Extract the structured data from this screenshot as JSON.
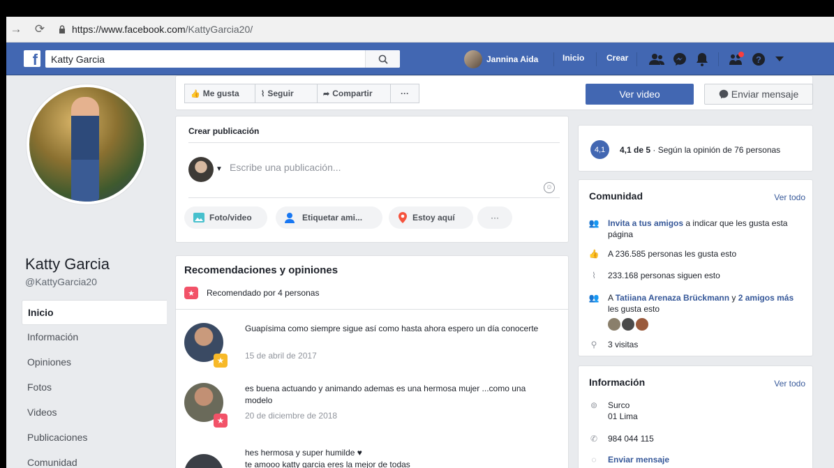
{
  "browser": {
    "url_prefix": "https://www.facebook.com",
    "url_path": "/KattyGarcia20/"
  },
  "fbbar": {
    "search_value": "Katty Garcia",
    "user_name": "Jannina Aida",
    "home_label": "Inicio",
    "create_label": "Crear"
  },
  "profile": {
    "name": "Katty Garcia",
    "handle": "@KattyGarcia20"
  },
  "left_nav": [
    {
      "label": "Inicio",
      "active": true
    },
    {
      "label": "Información"
    },
    {
      "label": "Opiniones"
    },
    {
      "label": "Fotos"
    },
    {
      "label": "Videos"
    },
    {
      "label": "Publicaciones"
    },
    {
      "label": "Comunidad"
    }
  ],
  "actions": {
    "like": "Me gusta",
    "follow": "Seguir",
    "share": "Compartir",
    "more": "···",
    "watch_video": "Ver video",
    "send_message": "Enviar mensaje"
  },
  "composer": {
    "title": "Crear publicación",
    "placeholder": "Escribe una publicación...",
    "photo": "Foto/video",
    "tag": "Etiquetar ami...",
    "checkin": "Estoy aquí",
    "more": "···"
  },
  "recommendations": {
    "title": "Recomendaciones y opiniones",
    "recommended_by": "Recomendado por 4 personas",
    "reviews": [
      {
        "text": "Guapísima como siempre sigue así como hasta ahora espero un día conocerte",
        "date": "15 de abril de 2017"
      },
      {
        "text": "es buena actuando  y animando ademas es una hermosa mujer ...como una modelo",
        "date": "20 de diciembre de 2018"
      },
      {
        "text": "hes hermosa y super humilde ♥",
        "text2": "te amooo katty garcia eres la mejor de todas"
      }
    ]
  },
  "rating": {
    "badge": "4,1",
    "score": "4,1 de 5",
    "detail": " · Según la opinión de 76 personas"
  },
  "community": {
    "title": "Comunidad",
    "see_all": "Ver todo",
    "invite_link": "Invita a tus amigos",
    "invite_rest": " a indicar que les gusta esta página",
    "likes": "A 236.585 personas les gusta esto",
    "follows": "233.168 personas siguen esto",
    "friends_prefix": "A ",
    "friends_link": "Tatiiana Arenaza Brückmann",
    "friends_mid": " y ",
    "friends_link2": "2 amigos más",
    "friends_suffix": " les gusta esto",
    "visits": "3 visitas"
  },
  "info": {
    "title": "Información",
    "see_all": "Ver todo",
    "address1": "Surco",
    "address2": "01 Lima",
    "phone": "984 044 115",
    "message_link": "Enviar mensaje"
  },
  "colors": {
    "fb_blue": "#4267b2",
    "link": "#365899",
    "background": "#e9ebee",
    "notification_red": "#fa3e3e"
  }
}
